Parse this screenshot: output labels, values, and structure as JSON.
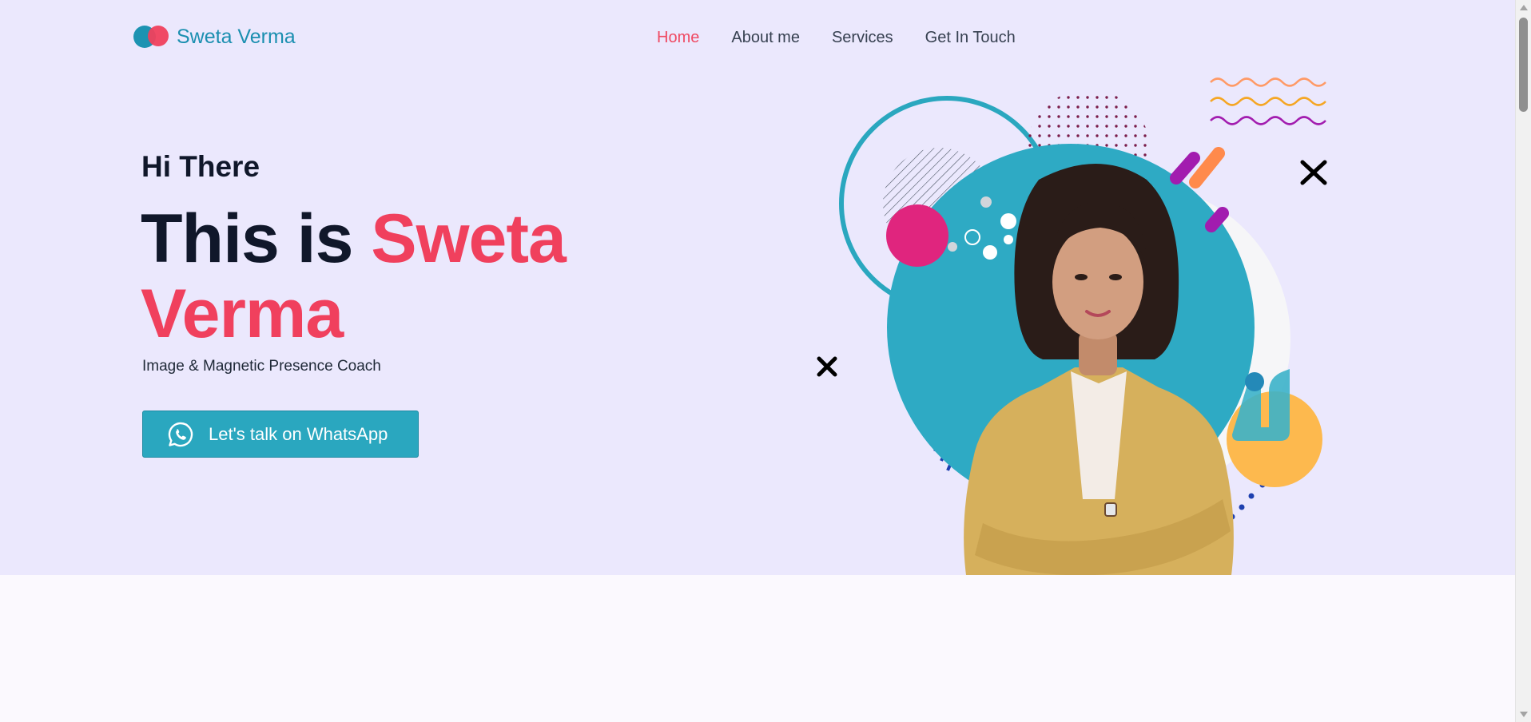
{
  "header": {
    "brand_name": "Sweta Verma",
    "nav": [
      {
        "label": "Home",
        "active": true
      },
      {
        "label": "About me",
        "active": false
      },
      {
        "label": "Services",
        "active": false
      },
      {
        "label": "Get In Touch",
        "active": false
      }
    ]
  },
  "hero": {
    "greeting": "Hi There",
    "headline_prefix": "This is ",
    "headline_name_first": "Sweta",
    "headline_name_last": "Verma",
    "subtitle": "Image & Magnetic Presence Coach",
    "cta_label": "Let's talk on WhatsApp",
    "cta_icon": "whatsapp-icon"
  },
  "colors": {
    "background": "#ebe8fd",
    "accent_pink": "#f0405d",
    "accent_teal": "#2aa7bf",
    "brand_teal": "#1b8fb0",
    "nav_active": "#ef4a63",
    "heading": "#10172a"
  }
}
